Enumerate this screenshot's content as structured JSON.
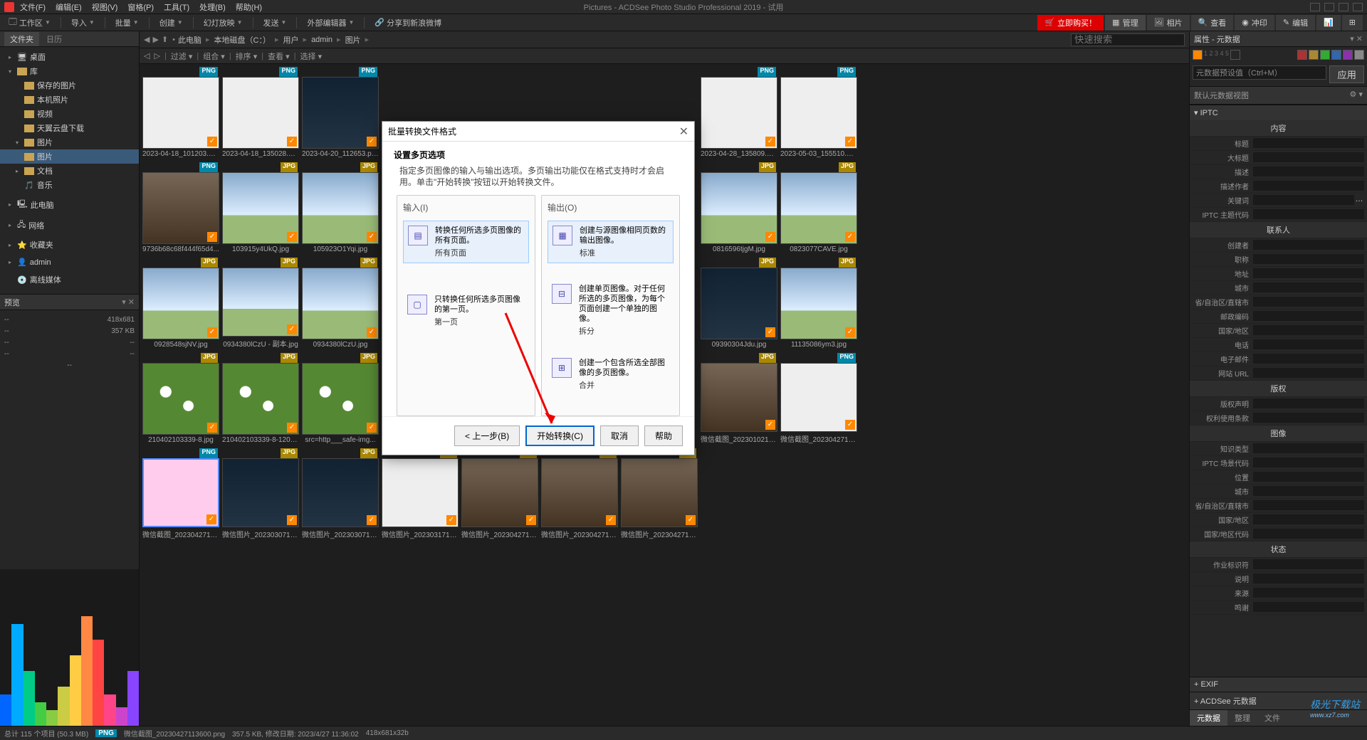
{
  "app": {
    "title": "Pictures - ACDSee Photo Studio Professional 2019 - 试用"
  },
  "menu": [
    "文件(F)",
    "编辑(E)",
    "视图(V)",
    "窗格(P)",
    "工具(T)",
    "处理(B)",
    "帮助(H)"
  ],
  "toolbar": {
    "workspace": "工作区",
    "import": "导入",
    "batch": "批量",
    "create": "创建",
    "slideshow": "幻灯放映",
    "send": "发送",
    "externaledit": "外部编辑器",
    "share": "分享到新浪微博"
  },
  "modes": {
    "buy": "立即购买！",
    "manage": "管理",
    "photos": "相片",
    "view": "查看",
    "develop": "冲印",
    "edit": "编辑"
  },
  "left_tabs": {
    "files": "文件夹",
    "calendar": "日历"
  },
  "tree": {
    "desktop": "桌面",
    "library": "库",
    "saved_pics": "保存的图片",
    "local_photos": "本机照片",
    "video": "视频",
    "cloud_dl": "天翼云盘下载",
    "pictures": "图片",
    "pictures2": "图片",
    "docs": "文档",
    "music": "音乐",
    "thispc": "此电脑",
    "network": "网络",
    "favs": "收藏夹",
    "admin": "admin",
    "offline": "离线媒体"
  },
  "preview": {
    "title": "预览",
    "dim": "418x681",
    "size": "357 KB",
    "dashrows": [
      [
        "--",
        "--"
      ],
      [
        "--",
        "--"
      ],
      [
        "--",
        "--"
      ]
    ]
  },
  "breadcrumb": {
    "items": [
      "此电脑",
      "本地磁盘（C：）",
      "用户",
      "admin",
      "图片"
    ],
    "search_ph": "快速搜索"
  },
  "filter": {
    "filter": "过滤",
    "group": "组合",
    "sort": "排序",
    "view": "查看",
    "select": "选择"
  },
  "thumbs": [
    {
      "name": "2023-04-18_101203.png",
      "badge": "PNG",
      "cls": "white",
      "checked": true
    },
    {
      "name": "2023-04-18_135028.png",
      "badge": "PNG",
      "cls": "white",
      "checked": true
    },
    {
      "name": "2023-04-20_112653.png",
      "badge": "PNG",
      "cls": "dark",
      "checked": true
    },
    {
      "name": "",
      "badge": "",
      "cls": "",
      "hidden": true
    },
    {
      "name": "",
      "badge": "",
      "cls": "",
      "hidden": true
    },
    {
      "name": "",
      "badge": "",
      "cls": "",
      "hidden": true
    },
    {
      "name": "",
      "badge": "",
      "cls": "",
      "hidden": true
    },
    {
      "name": "2023-04-28_135809.png",
      "badge": "PNG",
      "cls": "white",
      "checked": true
    },
    {
      "name": "2023-05-03_155510.png",
      "badge": "PNG",
      "cls": "white",
      "checked": true
    },
    {
      "name": "9736b68c68f444f65d4...",
      "badge": "PNG",
      "cls": "person",
      "checked": true
    },
    {
      "name": "103915y4UkQ.jpg",
      "badge": "JPG",
      "cls": "sky",
      "checked": true
    },
    {
      "name": "105923O1Yqi.jpg",
      "badge": "JPG",
      "cls": "sky",
      "checked": true
    },
    {
      "name": "",
      "badge": "",
      "cls": "",
      "hidden": true
    },
    {
      "name": "",
      "badge": "",
      "cls": "",
      "hidden": true
    },
    {
      "name": "",
      "badge": "",
      "cls": "",
      "hidden": true
    },
    {
      "name": "",
      "badge": "",
      "cls": "",
      "hidden": true
    },
    {
      "name": "0816596tjgM.jpg",
      "badge": "JPG",
      "cls": "sky",
      "checked": true
    },
    {
      "name": "0823077CAVE.jpg",
      "badge": "JPG",
      "cls": "sky",
      "checked": true
    },
    {
      "name": "0928548sjNV.jpg",
      "badge": "JPG",
      "cls": "sky",
      "checked": true
    },
    {
      "name": "0934380lCzU - 副本.jpg",
      "badge": "JPG",
      "cls": "sky",
      "checked": true
    },
    {
      "name": "0934380lCzU.jpg",
      "badge": "JPG",
      "cls": "sky",
      "checked": true
    },
    {
      "name": "",
      "badge": "",
      "cls": "",
      "hidden": true
    },
    {
      "name": "",
      "badge": "",
      "cls": "",
      "hidden": true
    },
    {
      "name": "",
      "badge": "",
      "cls": "",
      "hidden": true
    },
    {
      "name": "",
      "badge": "",
      "cls": "",
      "hidden": true
    },
    {
      "name": "09390304Jdu.jpg",
      "badge": "JPG",
      "cls": "dark",
      "checked": true
    },
    {
      "name": "11135086ym3.jpg",
      "badge": "JPG",
      "cls": "sky",
      "checked": true
    },
    {
      "name": "210402103339-8.jpg",
      "badge": "JPG",
      "cls": "flower",
      "checked": true
    },
    {
      "name": "210402103339-8-1200...",
      "badge": "JPG",
      "cls": "flower",
      "checked": true
    },
    {
      "name": "src=http___safe-img...",
      "badge": "JPG",
      "cls": "flower",
      "checked": true
    },
    {
      "name": "",
      "badge": "",
      "cls": "",
      "hidden": true
    },
    {
      "name": "",
      "badge": "",
      "cls": "",
      "hidden": true
    },
    {
      "name": "",
      "badge": "",
      "cls": "",
      "hidden": true
    },
    {
      "name": "",
      "badge": "",
      "cls": "",
      "hidden": true
    },
    {
      "name": "微信截图_20230102154...",
      "badge": "JPG",
      "cls": "person",
      "checked": true
    },
    {
      "name": "微信截图_20230427104...",
      "badge": "PNG",
      "cls": "white",
      "checked": true
    },
    {
      "name": "微信截图_20230427113...",
      "badge": "PNG",
      "cls": "cartoon",
      "checked": true,
      "sel": true
    },
    {
      "name": "微信图片_20230307153...",
      "badge": "JPG",
      "cls": "dark",
      "checked": true
    },
    {
      "name": "微信图片_20230307153...",
      "badge": "JPG",
      "cls": "dark",
      "checked": true
    },
    {
      "name": "微信图片_20230317105...",
      "badge": "JPG",
      "cls": "white",
      "checked": true
    },
    {
      "name": "微信图片_20230427125...",
      "badge": "JPG",
      "cls": "person",
      "checked": true
    },
    {
      "name": "微信图片_20230427125...",
      "badge": "JPG",
      "cls": "person",
      "checked": true
    },
    {
      "name": "微信图片_20230427125...",
      "badge": "JPG",
      "cls": "person",
      "checked": true
    }
  ],
  "right": {
    "title": "属性 - 元数据",
    "preset_ph": "元数据预设值（Ctrl+M）",
    "apply": "应用",
    "view_hdr": "默认元数据视图",
    "groups": {
      "iptc": "IPTC",
      "content": "内容",
      "contact": "联系人",
      "image": "图像",
      "status": "状态"
    },
    "fields": {
      "title": "标题",
      "headline": "大标题",
      "desc": "描述",
      "desc_author": "描述作者",
      "keywords": "关键词",
      "subject_code": "IPTC 主题代码",
      "creator": "创建者",
      "jobtitle": "职称",
      "address": "地址",
      "city": "城市",
      "state": "省/自治区/直辖市",
      "postal": "邮政编码",
      "country": "国家/地区",
      "phone": "电话",
      "email": "电子邮件",
      "website": "网站 URL",
      "copyright": "版权",
      "copyright_notice": "版权声明",
      "rights_terms": "权利使用条款",
      "intel_genre": "知识类型",
      "scene_code": "IPTC 场景代码",
      "location": "位置",
      "city2": "城市",
      "state2": "省/自治区/直辖市",
      "country2": "国家/地区",
      "country_code": "国家/地区代码",
      "job_id": "作业标识符",
      "instructions": "说明",
      "source": "来源",
      "credit": "鸣谢"
    },
    "collapse_exif": "EXIF",
    "collapse_acdsee": "ACDSee 元数据",
    "tabs": {
      "metadata": "元数据",
      "organize": "整理",
      "file": "文件"
    }
  },
  "status": {
    "total": "总计 115 个项目 (50.3 MB)",
    "badge": "PNG",
    "filename": "微信截图_20230427113600.png",
    "filesize": "357.5 KB, 修改日期: 2023/4/27 11:36:02",
    "dims": "418x681x32b"
  },
  "dialog": {
    "title": "批量转换文件格式",
    "subtitle": "设置多页选项",
    "desc": "指定多页图像的输入与输出选项。多页输出功能仅在格式支持时才会启用。单击\"开始转换\"按钮以开始转换文件。",
    "input_hdr": "输入(I)",
    "output_hdr": "输出(O)",
    "opt_all_pages": {
      "text": "转换任何所选多页图像的所有页面。",
      "name": "所有页面"
    },
    "opt_first_page": {
      "text": "只转换任何所选多页图像的第一页。",
      "name": "第一页"
    },
    "opt_standard": {
      "text": "创建与源图像相同页数的输出图像。",
      "name": "标准"
    },
    "opt_split": {
      "text": "创建单页图像。对于任何所选的多页图像，为每个页面创建一个单独的图像。",
      "name": "拆分"
    },
    "opt_merge": {
      "text": "创建一个包含所选全部图像的多页图像。",
      "name": "合并"
    },
    "btn_back": "< 上一步(B)",
    "btn_convert": "开始转换(C)",
    "btn_cancel": "取消",
    "btn_help": "帮助"
  },
  "watermark": {
    "main": "极光下载站",
    "sub": "www.xz7.com"
  }
}
